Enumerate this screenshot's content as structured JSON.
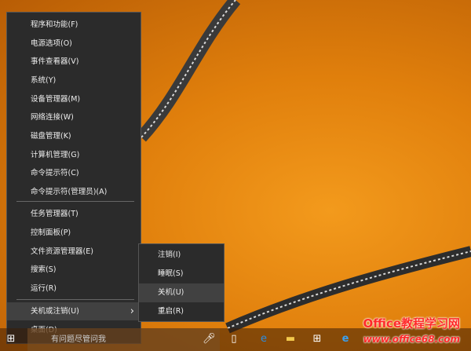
{
  "menu": {
    "items": [
      "程序和功能(F)",
      "电源选项(O)",
      "事件查看器(V)",
      "系统(Y)",
      "设备管理器(M)",
      "网络连接(W)",
      "磁盘管理(K)",
      "计算机管理(G)",
      "命令提示符(C)",
      "命令提示符(管理员)(A)",
      "任务管理器(T)",
      "控制面板(P)",
      "文件资源管理器(E)",
      "搜索(S)",
      "运行(R)",
      "关机或注销(U)",
      "桌面(D)"
    ],
    "arrow": "›"
  },
  "submenu": {
    "items": [
      "注销(I)",
      "睡眠(S)",
      "关机(U)",
      "重启(R)"
    ]
  },
  "taskbar": {
    "search_placeholder": "有问题尽管问我",
    "icons": [
      "start-icon",
      "microphone-icon",
      "task-view-icon",
      "edge-icon",
      "file-explorer-icon",
      "store-icon",
      "ie-icon"
    ]
  },
  "watermark": {
    "line1": "Office教程学习网",
    "line2": "www.office68.com"
  }
}
